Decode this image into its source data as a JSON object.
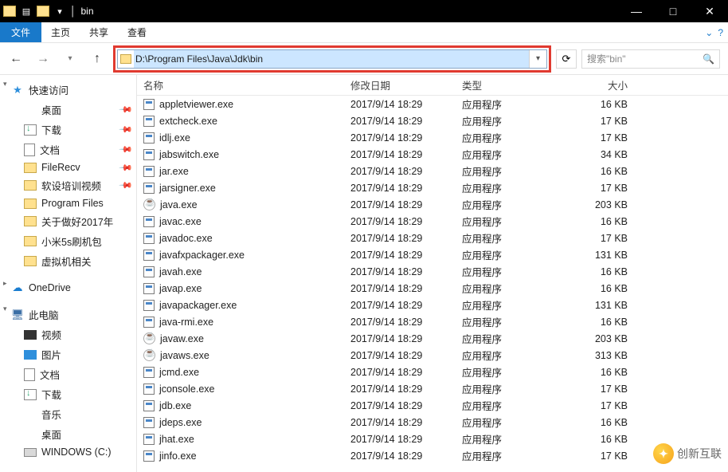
{
  "window": {
    "title": "bin",
    "buttons": {
      "min": "—",
      "max": "□",
      "close": "✕"
    }
  },
  "ribbon": {
    "file": "文件",
    "tabs": [
      "主页",
      "共享",
      "查看"
    ],
    "help": "?"
  },
  "nav": {
    "path": "D:\\Program Files\\Java\\Jdk\\bin",
    "refresh": "⟳",
    "search_placeholder": "搜索\"bin\""
  },
  "sidebar": {
    "quick": {
      "label": "快速访问",
      "icon": "star"
    },
    "quick_items": [
      {
        "label": "桌面",
        "icon": "desktop",
        "pinned": true
      },
      {
        "label": "下载",
        "icon": "download",
        "pinned": true
      },
      {
        "label": "文档",
        "icon": "doc",
        "pinned": true
      },
      {
        "label": "FileRecv",
        "icon": "folder",
        "pinned": true
      },
      {
        "label": "软设培训视频",
        "icon": "folder",
        "pinned": true
      },
      {
        "label": "Program Files",
        "icon": "folder",
        "pinned": false
      },
      {
        "label": "关于做好2017年",
        "icon": "folder",
        "pinned": false
      },
      {
        "label": "小米5s刷机包",
        "icon": "folder",
        "pinned": false
      },
      {
        "label": "虚拟机相关",
        "icon": "folder",
        "pinned": false
      }
    ],
    "onedrive": {
      "label": "OneDrive",
      "icon": "onedrive"
    },
    "thispc": {
      "label": "此电脑",
      "icon": "pc"
    },
    "pc_items": [
      {
        "label": "视频",
        "icon": "video"
      },
      {
        "label": "图片",
        "icon": "pic"
      },
      {
        "label": "文档",
        "icon": "doc"
      },
      {
        "label": "下载",
        "icon": "download"
      },
      {
        "label": "音乐",
        "icon": "music"
      },
      {
        "label": "桌面",
        "icon": "desktop"
      },
      {
        "label": "WINDOWS (C:)",
        "icon": "disk"
      }
    ]
  },
  "columns": {
    "name": "名称",
    "date": "修改日期",
    "type": "类型",
    "size": "大小"
  },
  "files": [
    {
      "name": "appletviewer.exe",
      "date": "2017/9/14 18:29",
      "type": "应用程序",
      "size": "16 KB",
      "ico": "exe"
    },
    {
      "name": "extcheck.exe",
      "date": "2017/9/14 18:29",
      "type": "应用程序",
      "size": "17 KB",
      "ico": "exe"
    },
    {
      "name": "idlj.exe",
      "date": "2017/9/14 18:29",
      "type": "应用程序",
      "size": "17 KB",
      "ico": "exe"
    },
    {
      "name": "jabswitch.exe",
      "date": "2017/9/14 18:29",
      "type": "应用程序",
      "size": "34 KB",
      "ico": "exe"
    },
    {
      "name": "jar.exe",
      "date": "2017/9/14 18:29",
      "type": "应用程序",
      "size": "16 KB",
      "ico": "exe"
    },
    {
      "name": "jarsigner.exe",
      "date": "2017/9/14 18:29",
      "type": "应用程序",
      "size": "17 KB",
      "ico": "exe"
    },
    {
      "name": "java.exe",
      "date": "2017/9/14 18:29",
      "type": "应用程序",
      "size": "203 KB",
      "ico": "java"
    },
    {
      "name": "javac.exe",
      "date": "2017/9/14 18:29",
      "type": "应用程序",
      "size": "16 KB",
      "ico": "exe"
    },
    {
      "name": "javadoc.exe",
      "date": "2017/9/14 18:29",
      "type": "应用程序",
      "size": "17 KB",
      "ico": "exe"
    },
    {
      "name": "javafxpackager.exe",
      "date": "2017/9/14 18:29",
      "type": "应用程序",
      "size": "131 KB",
      "ico": "exe"
    },
    {
      "name": "javah.exe",
      "date": "2017/9/14 18:29",
      "type": "应用程序",
      "size": "16 KB",
      "ico": "exe"
    },
    {
      "name": "javap.exe",
      "date": "2017/9/14 18:29",
      "type": "应用程序",
      "size": "16 KB",
      "ico": "exe"
    },
    {
      "name": "javapackager.exe",
      "date": "2017/9/14 18:29",
      "type": "应用程序",
      "size": "131 KB",
      "ico": "exe"
    },
    {
      "name": "java-rmi.exe",
      "date": "2017/9/14 18:29",
      "type": "应用程序",
      "size": "16 KB",
      "ico": "exe"
    },
    {
      "name": "javaw.exe",
      "date": "2017/9/14 18:29",
      "type": "应用程序",
      "size": "203 KB",
      "ico": "java"
    },
    {
      "name": "javaws.exe",
      "date": "2017/9/14 18:29",
      "type": "应用程序",
      "size": "313 KB",
      "ico": "java"
    },
    {
      "name": "jcmd.exe",
      "date": "2017/9/14 18:29",
      "type": "应用程序",
      "size": "16 KB",
      "ico": "exe"
    },
    {
      "name": "jconsole.exe",
      "date": "2017/9/14 18:29",
      "type": "应用程序",
      "size": "17 KB",
      "ico": "exe"
    },
    {
      "name": "jdb.exe",
      "date": "2017/9/14 18:29",
      "type": "应用程序",
      "size": "17 KB",
      "ico": "exe"
    },
    {
      "name": "jdeps.exe",
      "date": "2017/9/14 18:29",
      "type": "应用程序",
      "size": "16 KB",
      "ico": "exe"
    },
    {
      "name": "jhat.exe",
      "date": "2017/9/14 18:29",
      "type": "应用程序",
      "size": "16 KB",
      "ico": "exe"
    },
    {
      "name": "jinfo.exe",
      "date": "2017/9/14 18:29",
      "type": "应用程序",
      "size": "17 KB",
      "ico": "exe"
    }
  ],
  "watermark": "创新互联"
}
